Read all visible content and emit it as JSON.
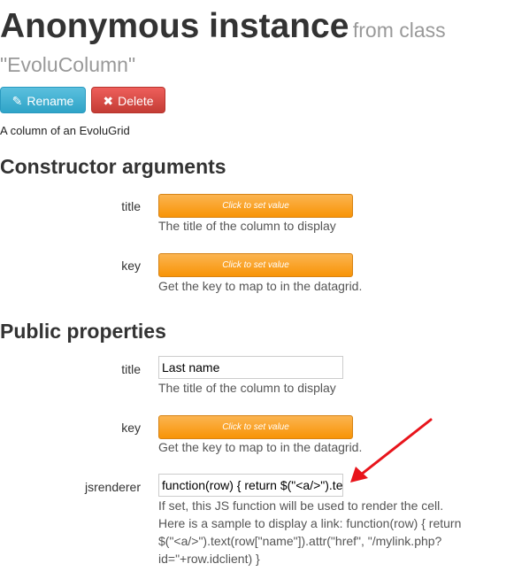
{
  "header": {
    "title": "Anonymous instance",
    "from_class_prefix": "from class",
    "class_name": "\"EvoluColumn\""
  },
  "actions": {
    "rename_label": "Rename",
    "delete_label": "Delete"
  },
  "description": "A column of an EvoluGrid",
  "constructor": {
    "heading": "Constructor arguments",
    "args": [
      {
        "label": "title",
        "button": "Click to set value",
        "help": "The title of the column to display"
      },
      {
        "label": "key",
        "button": "Click to set value",
        "help": "Get the key to map to in the datagrid."
      }
    ]
  },
  "properties": {
    "heading": "Public properties",
    "title": {
      "label": "title",
      "value": "Last name",
      "help": "The title of the column to display"
    },
    "key": {
      "label": "key",
      "button": "Click to set value",
      "help": "Get the key to map to in the datagrid."
    },
    "jsrenderer": {
      "label": "jsrenderer",
      "value": "function(row) { return $(\"<a/>\").text(row[\"name\"]).attr(\"href\", \"/mylink.php?id=\"+row.idclient) }",
      "help_line1": "If set, this JS function will be used to render the cell.",
      "help_line2": "Here is a sample to display a link: function(row) { return",
      "help_line3": "$(\"<a/>\").text(row[\"name\"]).attr(\"href\", \"/mylink.php?",
      "help_line4": "id=\"+row.idclient) }"
    }
  },
  "colors": {
    "info": "#5bc0de",
    "danger": "#da4f49",
    "warning": "#f89406",
    "arrow": "#e8141b"
  }
}
